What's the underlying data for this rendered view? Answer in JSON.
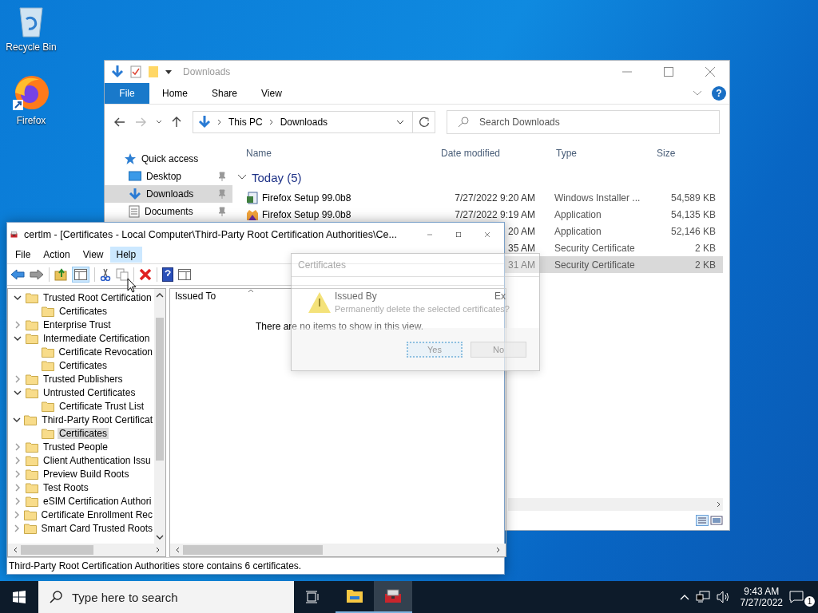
{
  "desktop_icons": [
    {
      "label": "Recycle Bin",
      "kind": "recycle"
    },
    {
      "label": "Firefox",
      "kind": "firefox"
    }
  ],
  "explorer": {
    "title": "Downloads",
    "ribbon_tabs": [
      {
        "label": "File",
        "kind": "file"
      },
      {
        "label": "Home",
        "kind": "tab"
      },
      {
        "label": "Share",
        "kind": "tab"
      },
      {
        "label": "View",
        "kind": "tab"
      }
    ],
    "help_glyph": "?",
    "address": [
      "This PC",
      "Downloads"
    ],
    "search": {
      "placeholder": "Search Downloads"
    },
    "nav": [
      {
        "label": "Quick access",
        "kind": "star",
        "selected": false,
        "pinned": false
      },
      {
        "label": "Desktop",
        "kind": "desktop",
        "selected": false,
        "pinned": true
      },
      {
        "label": "Downloads",
        "kind": "download",
        "selected": true,
        "pinned": true
      },
      {
        "label": "Documents",
        "kind": "document",
        "selected": false,
        "pinned": true
      }
    ],
    "columns": [
      "Name",
      "Date modified",
      "Type",
      "Size"
    ],
    "group": "Today (5)",
    "rows": [
      {
        "kind": "installer",
        "name": "Firefox Setup 99.0b8",
        "date": "7/27/2022 9:20 AM",
        "type": "Windows Installer ...",
        "size": "54,589 KB",
        "selected": false
      },
      {
        "kind": "firefox",
        "name": "Firefox Setup 99.0b8",
        "date": "7/27/2022 9:19 AM",
        "type": "Application",
        "size": "54,135 KB",
        "selected": false
      },
      {
        "date": "20 AM",
        "type": "Application",
        "size": "52,146 KB",
        "selected": false
      },
      {
        "date": "35 AM",
        "type": "Security Certificate",
        "size": "2 KB",
        "selected": false
      },
      {
        "date": "31 AM",
        "type": "Security Certificate",
        "size": "2 KB",
        "selected": true
      }
    ]
  },
  "certlm": {
    "title": "certlm - [Certificates - Local Computer\\Third-Party Root Certification Authorities\\Ce...",
    "menu": [
      {
        "label": "File",
        "selected": false
      },
      {
        "label": "Action",
        "selected": false
      },
      {
        "label": "View",
        "selected": false
      },
      {
        "label": "Help",
        "selected": true
      }
    ],
    "tree": [
      {
        "label": "Trusted Root Certification",
        "expanded": true,
        "selected": false,
        "children": [
          {
            "label": "Certificates",
            "selected": false
          }
        ]
      },
      {
        "label": "Enterprise Trust",
        "expanded": false,
        "selected": false
      },
      {
        "label": "Intermediate Certification",
        "expanded": true,
        "selected": false,
        "children": [
          {
            "label": "Certificate Revocation",
            "selected": false
          },
          {
            "label": "Certificates",
            "selected": false
          }
        ]
      },
      {
        "label": "Trusted Publishers",
        "expanded": false,
        "selected": false
      },
      {
        "label": "Untrusted Certificates",
        "expanded": true,
        "selected": false,
        "children": [
          {
            "label": "Certificate Trust List",
            "selected": false
          }
        ]
      },
      {
        "label": "Third-Party Root Certificat",
        "expanded": true,
        "selected": false,
        "children": [
          {
            "label": "Certificates",
            "selected": true
          }
        ]
      },
      {
        "label": "Trusted People",
        "expanded": false,
        "selected": false
      },
      {
        "label": "Client Authentication Issu",
        "expanded": false,
        "selected": false
      },
      {
        "label": "Preview Build Roots",
        "expanded": false,
        "selected": false
      },
      {
        "label": "Test Roots",
        "expanded": false,
        "selected": false
      },
      {
        "label": "eSIM Certification Authori",
        "expanded": false,
        "selected": false
      },
      {
        "label": "Certificate Enrollment Rec",
        "expanded": false,
        "selected": false
      },
      {
        "label": "Smart Card Trusted Roots",
        "expanded": false,
        "selected": false
      }
    ],
    "columns": [
      "Issued To",
      "Issued By",
      "Ex"
    ],
    "empty_message": "There are no items to show in this view.",
    "status": "Third-Party Root Certification Authorities store contains 6 certificates."
  },
  "dialog": {
    "title": "Certificates",
    "message": "Permanently delete the selected certificates?",
    "buttons": [
      {
        "label": "Yes",
        "focused": true
      },
      {
        "label": "No",
        "focused": false
      }
    ]
  },
  "taskbar": {
    "search_placeholder": "Type here to search",
    "apps": [
      {
        "kind": "explorer",
        "selected": false
      },
      {
        "kind": "certlm",
        "selected": true
      }
    ],
    "time": "9:43 AM",
    "date": "7/27/2022",
    "notification_count": "1"
  }
}
